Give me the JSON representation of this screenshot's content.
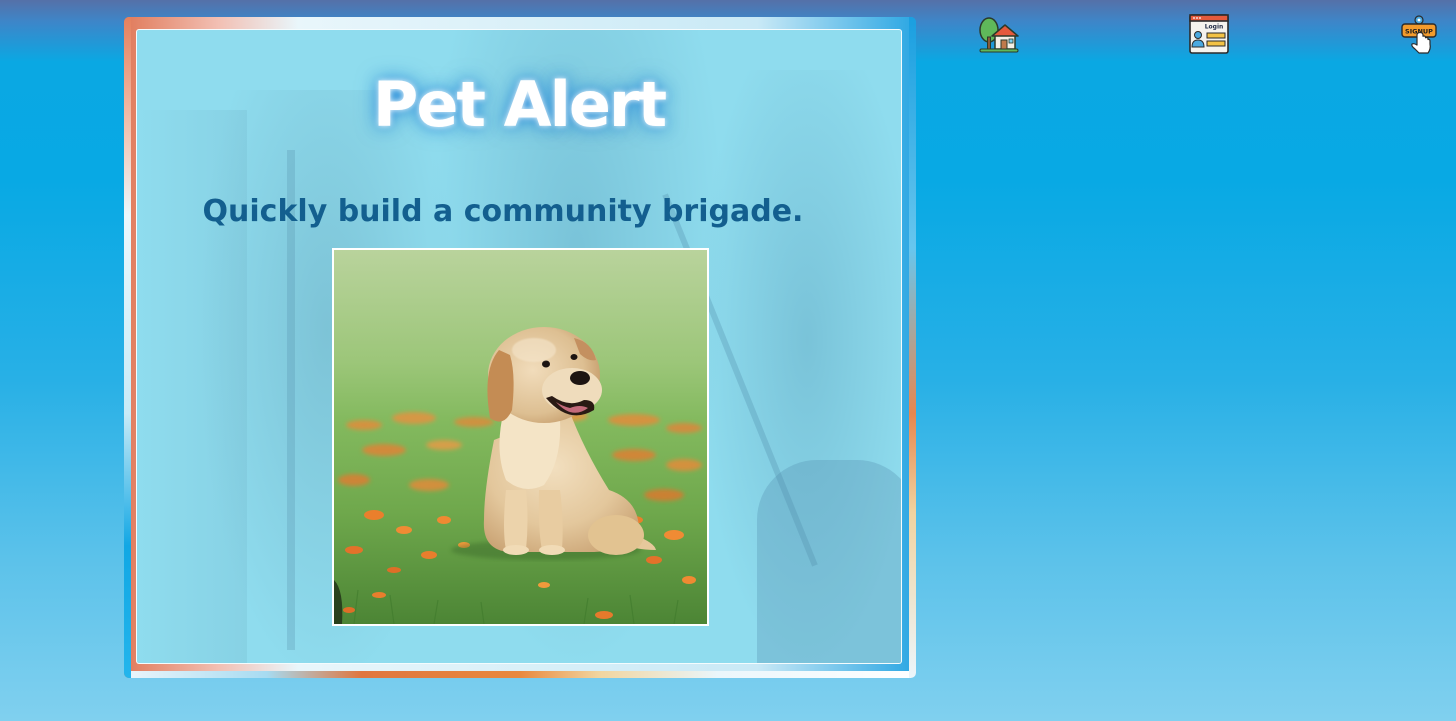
{
  "hero": {
    "title": "Pet Alert",
    "subtitle": "Quickly build a community brigade.",
    "image_alt": "Golden retriever puppy sitting in grass with orange flowers"
  },
  "nav": {
    "items": [
      {
        "icon": "home-icon",
        "label": "Home"
      },
      {
        "icon": "login-icon",
        "label": "Login",
        "badge_text": "Login"
      },
      {
        "icon": "signup-icon",
        "label": "Sign Up",
        "badge_text": "SIGNUP"
      }
    ]
  },
  "colors": {
    "page_top": "#5570a8",
    "page_main": "#08a9e4",
    "page_bottom": "#80d0ef",
    "panel_bg": "#8fdcee",
    "title_text": "#ffffff",
    "subtitle_text": "#135f8f",
    "frame_accent_orange": "#e0763f"
  }
}
